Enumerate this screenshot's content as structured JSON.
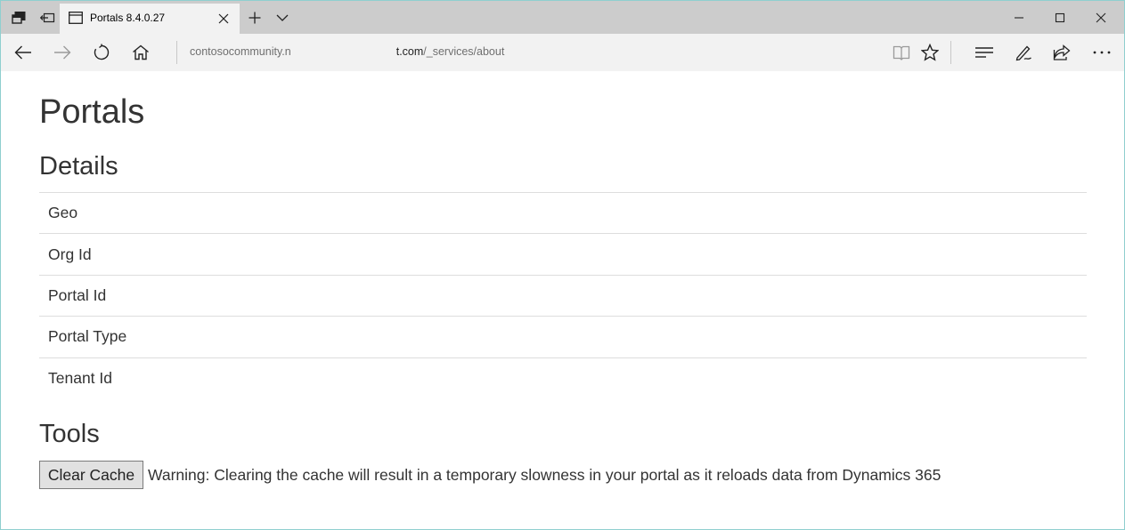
{
  "browser": {
    "tab": {
      "title": "Portals 8.4.0.27"
    },
    "address": {
      "url_start": "contosocommunity.n",
      "url_domain_end": "t.com",
      "url_path": "/_services/about"
    }
  },
  "page": {
    "title": "Portals",
    "details": {
      "heading": "Details",
      "rows": [
        "Geo",
        "Org Id",
        "Portal Id",
        "Portal Type",
        "Tenant Id"
      ]
    },
    "tools": {
      "heading": "Tools",
      "clear_cache_label": "Clear Cache",
      "warning": "Warning: Clearing the cache will result in a temporary slowness in your portal as it reloads data from Dynamics 365"
    }
  },
  "icons": {
    "tab_actions": [
      "tab-preview-icon",
      "set-tabs-aside-icon",
      "new-tab-icon",
      "tab-list-chevron-icon"
    ],
    "nav": [
      "back-arrow-icon",
      "forward-arrow-icon",
      "refresh-icon",
      "home-icon"
    ],
    "toolbar": [
      "reading-view-icon",
      "favorite-star-icon",
      "hub-icon",
      "web-note-icon",
      "share-icon",
      "more-icon"
    ],
    "window": [
      "minimize-icon",
      "maximize-icon",
      "close-window-icon"
    ]
  },
  "colors": {
    "tabbar_bg": "#cccccc",
    "active_tab_bg": "#f2f2f2",
    "text": "#333333",
    "divider": "#dddddd",
    "button_bg": "#e1e1e1"
  }
}
